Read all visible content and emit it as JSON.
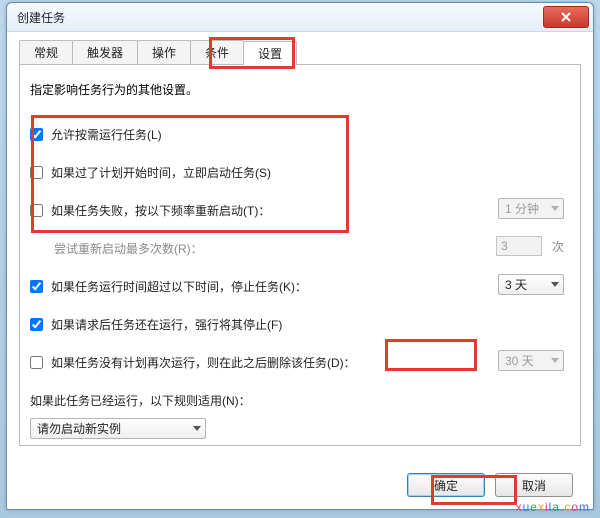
{
  "window": {
    "title": "创建任务",
    "close_icon": "close"
  },
  "tabs": {
    "items": [
      {
        "label": "常规"
      },
      {
        "label": "触发器"
      },
      {
        "label": "操作"
      },
      {
        "label": "条件"
      },
      {
        "label": "设置"
      }
    ],
    "active_index": 4
  },
  "settings": {
    "intro": "指定影响任务行为的其他设置。",
    "allow_demand": {
      "label": "允许按需运行任务(L)",
      "checked": true
    },
    "run_asap": {
      "label": "如果过了计划开始时间，立即启动任务(S)",
      "checked": false
    },
    "restart_on_fail": {
      "label": "如果任务失败，按以下频率重新启动(T)：",
      "checked": false,
      "interval": "1 分钟"
    },
    "retry": {
      "label": "尝试重新启动最多次数(R)：",
      "value": "3",
      "suffix": "次"
    },
    "stop_if_long": {
      "label": "如果任务运行时间超过以下时间，停止任务(K)：",
      "checked": true,
      "value": "3 天"
    },
    "force_stop": {
      "label": "如果请求后任务还在运行，强行将其停止(F)",
      "checked": true
    },
    "delete_if_unscheduled": {
      "label": "如果任务没有计划再次运行，则在此之后删除该任务(D)：",
      "checked": false,
      "value": "30 天"
    },
    "if_running": {
      "label": "如果此任务已经运行，以下规则适用(N)：",
      "value": "请勿启动新实例"
    }
  },
  "buttons": {
    "ok": "确定",
    "cancel": "取消"
  },
  "watermark": "xuexila.com"
}
